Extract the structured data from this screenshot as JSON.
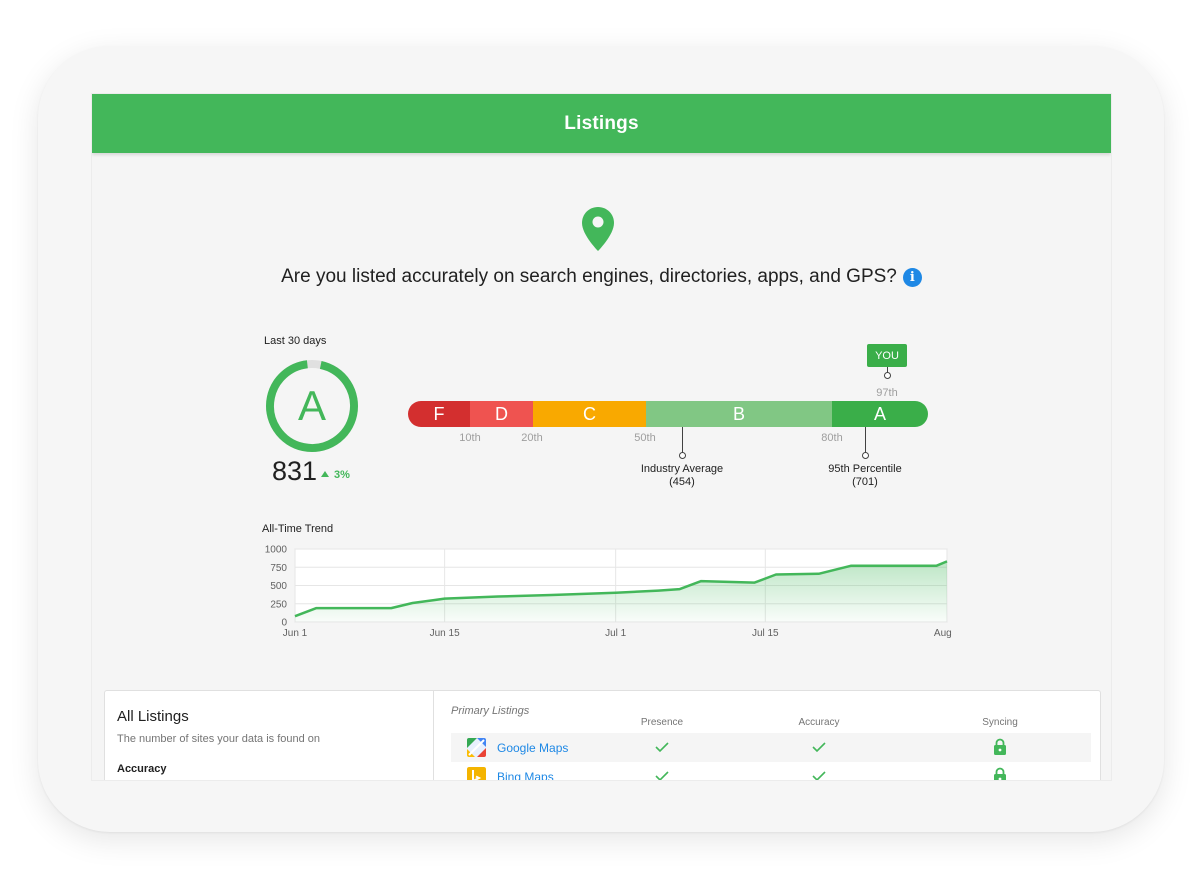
{
  "header": {
    "title": "Listings"
  },
  "hero": {
    "question": "Are you listed accurately on search engines, directories, apps, and GPS?",
    "info_glyph": "i"
  },
  "summary": {
    "period_label": "Last 30 days",
    "grade": "A",
    "score": "831",
    "delta": "3%"
  },
  "grade_scale": {
    "segments": [
      "F",
      "D",
      "C",
      "B",
      "A"
    ],
    "ticks": [
      "10th",
      "20th",
      "50th",
      "80th"
    ],
    "you_label": "YOU",
    "you_percentile": "97th",
    "markers": [
      {
        "label": "Industry Average",
        "value": "(454)"
      },
      {
        "label": "95th Percentile",
        "value": "(701)"
      }
    ],
    "colors": {
      "F": "#d32f2f",
      "D": "#ef5350",
      "C": "#f9a900",
      "B": "#81c784",
      "A": "#3aae49"
    }
  },
  "trend": {
    "title": "All-Time Trend"
  },
  "chart_data": {
    "type": "area",
    "title": "All-Time Trend",
    "x": [
      "Jun 1",
      "Jun 3",
      "Jun 10",
      "Jun 12",
      "Jun 14",
      "Jun 15",
      "Jun 20",
      "Jun 25",
      "Jul 1",
      "Jul 5",
      "Jul 7",
      "Jul 9",
      "Jul 14",
      "Jul 16",
      "Jul 20",
      "Jul 23",
      "Jul 31",
      "Aug 1"
    ],
    "series": [
      {
        "values": [
          80,
          190,
          190,
          260,
          300,
          320,
          350,
          370,
          400,
          430,
          450,
          560,
          540,
          650,
          660,
          770,
          770,
          830
        ]
      }
    ],
    "xticks": [
      "Jun 1",
      "Jun 15",
      "Jul 1",
      "Jul 15",
      "Aug 1"
    ],
    "yticks": [
      0,
      250,
      500,
      750,
      1000
    ],
    "ylim": [
      0,
      1000
    ],
    "grid": true,
    "color": "#43b75a"
  },
  "listings": {
    "title": "All Listings",
    "subtitle": "The number of sites your data is found on",
    "accuracy_label": "Accuracy",
    "primary_title": "Primary Listings",
    "columns": [
      "Presence",
      "Accuracy",
      "Syncing"
    ],
    "rows": [
      {
        "name": "Google Maps",
        "icon": "google-maps-icon"
      },
      {
        "name": "Bing Maps",
        "icon": "bing-icon"
      }
    ]
  }
}
